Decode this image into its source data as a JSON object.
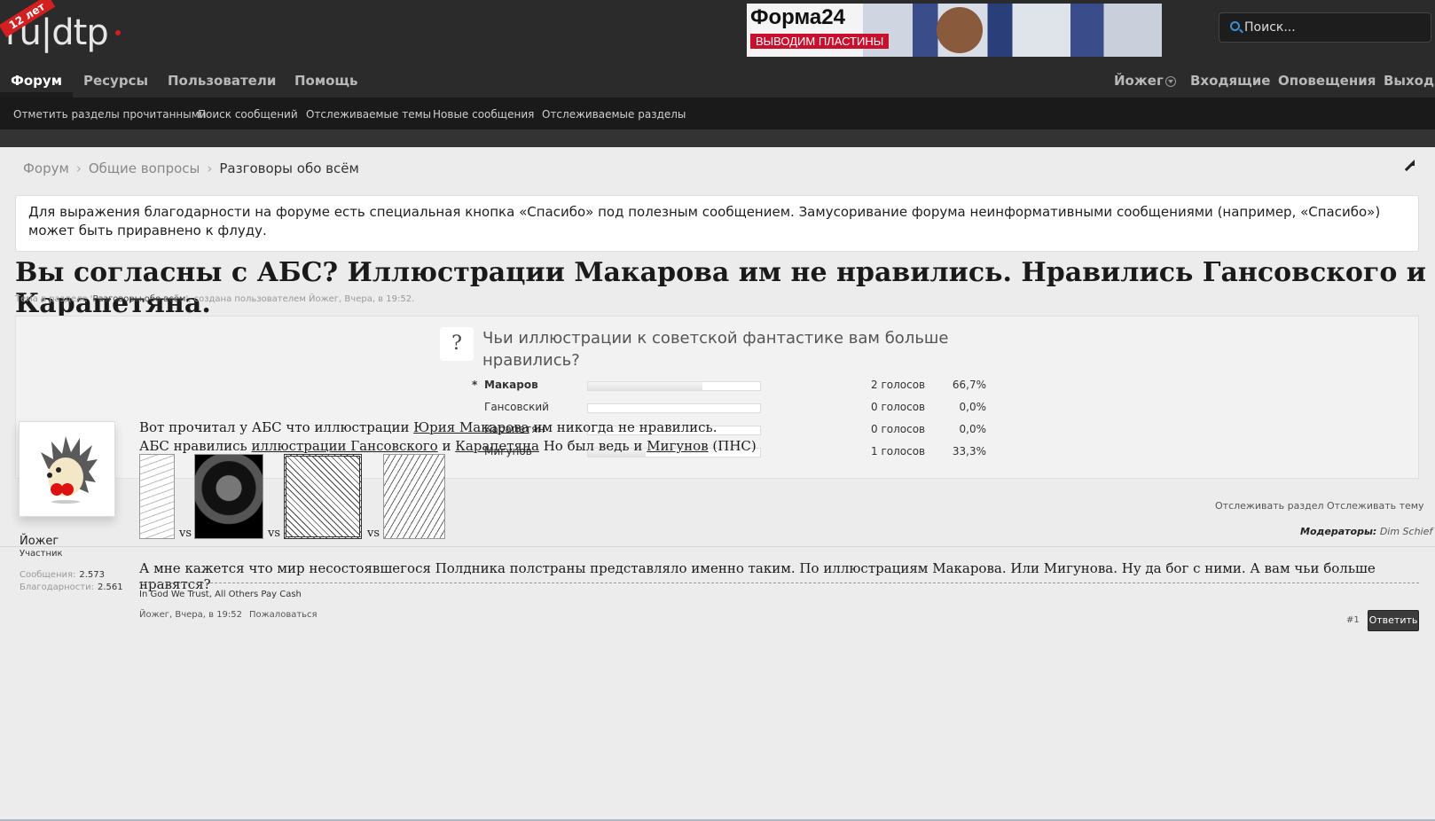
{
  "header": {
    "logo_text": "ru|dtp",
    "logo_ribbon": "12 лет",
    "banner": {
      "title": "Форма24",
      "subtitle": "ВЫВОДИМ ПЛАСТИНЫ"
    },
    "search_placeholder": "Поиск...",
    "nav": [
      "Форум",
      "Ресурсы",
      "Пользователи",
      "Помощь"
    ],
    "nav_right": {
      "user": "Йожег",
      "inbox": "Входящие",
      "alerts": "Оповещения",
      "logout": "Выход"
    },
    "subnav": [
      "Отметить разделы прочитанными",
      "Поиск сообщений",
      "Отслеживаемые темы",
      "Новые сообщения",
      "Отслеживаемые разделы"
    ]
  },
  "breadcrumb": [
    "Форум",
    "Общие вопросы",
    "Разговоры обо всём"
  ],
  "notice": "Для выражения благодарности на форуме есть специальная кнопка «Спасибо» под полезным сообщением. Замусоривание форума неинформативными сообщениями (например, «Спасибо») может быть приравнено к флуду.",
  "thread": {
    "title": "Вы согласны с АБС? Иллюстрации Макарова им не нравились. Нравились Гансовского и Карапетяна.",
    "meta_prefix": "Тема в разделе '",
    "meta_forum": "Разговоры обо всём",
    "meta_mid": "', создана пользователем ",
    "meta_author": "Йожег",
    "meta_date": ", Вчера, в 19:52."
  },
  "poll": {
    "question": "Чьи иллюстрации к советской фантастике вам больше нравились?",
    "options": [
      {
        "mark": "*",
        "label": "Макаров",
        "votes": "2 голосов",
        "percent": "66,7%",
        "fraction": 0.667
      },
      {
        "mark": "",
        "label": "Гансовский",
        "votes": "0 голосов",
        "percent": "0,0%",
        "fraction": 0
      },
      {
        "mark": "",
        "label": "Карапетян",
        "votes": "0 голосов",
        "percent": "0,0%",
        "fraction": 0
      },
      {
        "mark": "",
        "label": "Мигунов",
        "votes": "1 голосов",
        "percent": "33,3%",
        "fraction": 0.333
      }
    ]
  },
  "actions": {
    "watch_forum": "Отслеживать раздел",
    "watch_thread": "Отслеживать тему"
  },
  "moderators": {
    "label": "Модераторы:",
    "name": "Dim Schief"
  },
  "post": {
    "author": "Йожег",
    "user_title": "Участник",
    "stats": [
      {
        "label": "Сообщения:",
        "value": "2.573"
      },
      {
        "label": "Благодарности:",
        "value": "2.561"
      }
    ],
    "line1_a": "Вот прочитал у АБС что иллюстрации ",
    "link1": "Юрия Макарова",
    "line1_b": " им никогда не нравились.",
    "line2_a": "АБС нравились ",
    "link2": "иллюстрации Гансовского",
    "line2_b": " и ",
    "link3": "Карапетяна",
    "line2_c": " Но был ведь и ",
    "link4": "Мигунов",
    "line2_d": " (ПНС)",
    "vs": "vs",
    "text2": "А мне кажется что мир несостоявшегося Полдника полстраны представляло именно таким. По иллюстрациям Макарова. Или Мигунова. Ну да бог с ними. А вам чьи больше нравятся?",
    "signature": "In God We Trust, All Others Pay Cash",
    "meta_author": "Йожег",
    "meta_date": ", Вчера, в 19:52",
    "report": "Пожаловаться",
    "number": "#1",
    "reply": "Ответить"
  }
}
